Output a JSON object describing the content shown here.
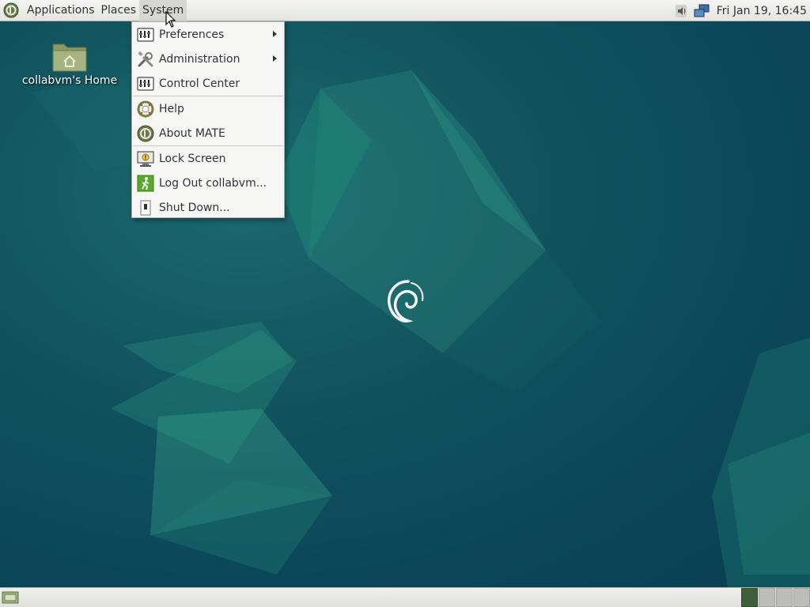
{
  "top_panel": {
    "menus": [
      "Applications",
      "Places",
      "System"
    ],
    "clock": "Fri Jan 19, 16:45"
  },
  "desktop": {
    "home_icon_label": "collabvm's Home"
  },
  "system_menu": {
    "items": [
      {
        "label": "Preferences",
        "icon": "preferences-icon",
        "submenu": true
      },
      {
        "label": "Administration",
        "icon": "administration-icon",
        "submenu": true
      },
      {
        "label": "Control Center",
        "icon": "control-center-icon",
        "submenu": false
      },
      {
        "label": "Help",
        "icon": "help-icon",
        "submenu": false
      },
      {
        "label": "About MATE",
        "icon": "mate-logo-icon",
        "submenu": false
      },
      {
        "label": "Lock Screen",
        "icon": "lock-screen-icon",
        "submenu": false
      },
      {
        "label": "Log Out collabvm...",
        "icon": "log-out-icon",
        "submenu": false
      },
      {
        "label": "Shut Down...",
        "icon": "shut-down-icon",
        "submenu": false
      }
    ]
  },
  "colors": {
    "desktop_bg": "#0b4558",
    "panel_bg": "#e8e8e4",
    "menu_bg": "#f6f6f4",
    "accent_green": "#3f5f3a"
  },
  "workspaces": {
    "count": 4,
    "current": 1
  }
}
